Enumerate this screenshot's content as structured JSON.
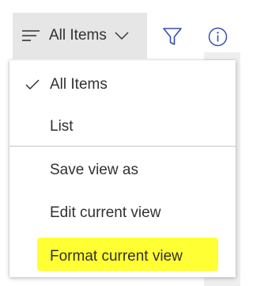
{
  "command_bar": {
    "view_switcher_label": "All Items",
    "icons": {
      "view": "view-lines-icon",
      "dropdown": "chevron-down-icon",
      "filter": "filter-icon",
      "info": "info-icon"
    }
  },
  "view_menu": {
    "items": [
      {
        "label": "All Items",
        "checked": true
      },
      {
        "label": "List",
        "checked": false
      },
      {
        "label": "Save view as"
      },
      {
        "label": "Edit current view"
      },
      {
        "label": "Format current view",
        "highlighted": true
      }
    ],
    "highlight_color": "#ffff33",
    "accent_color": "#3a4db0"
  }
}
